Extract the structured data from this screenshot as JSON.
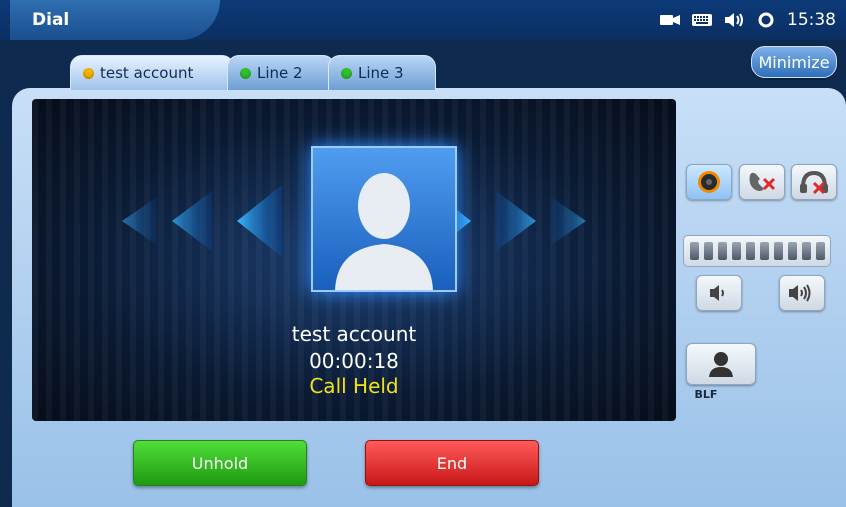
{
  "app": {
    "title": "Dial",
    "time": "15:38"
  },
  "status_icons": [
    "camera-icon",
    "keyboard-icon",
    "speaker-icon",
    "sync-icon"
  ],
  "minimize_label": "Minimize",
  "tabs": [
    {
      "label": "test account",
      "dot_color": "#f5b400",
      "active": true
    },
    {
      "label": "Line 2",
      "dot_color": "#2fc12f",
      "active": false
    },
    {
      "label": "Line 3",
      "dot_color": "#2fc12f",
      "active": false
    }
  ],
  "call": {
    "name": "test account",
    "duration": "00:00:18",
    "state": "Call Held"
  },
  "controls": {
    "record_icon": "record-icon",
    "mute_icon": "mute-mic-icon",
    "headset_icon": "headset-off-icon",
    "volume_down_icon": "volume-down-icon",
    "volume_up_icon": "volume-up-icon",
    "blf_label": "BLF"
  },
  "buttons": {
    "unhold": "Unhold",
    "end": "End"
  },
  "colors": {
    "held": "#f0e020",
    "unhold": "#2bb51a",
    "end": "#e02a2a"
  }
}
